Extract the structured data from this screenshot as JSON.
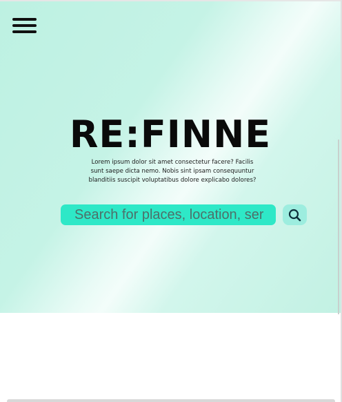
{
  "header": {
    "menu_icon": "hamburger-menu-icon"
  },
  "hero": {
    "title": "RE:FINNE",
    "tagline_lines": [
      "Lorem ipsum dolor sit amet consectetur facere? Facilis",
      "sunt saepe dicta nemo. Nobis sint ipsam consequuntur",
      "blanditiis suscipit voluptatibus dolore explicabo dolores?"
    ]
  },
  "search": {
    "placeholder": "Search for places, location, services...",
    "button_icon": "search-icon"
  },
  "colors": {
    "hero_gradient_mint": "#bdf1e2",
    "search_field": "#2ee8c7",
    "search_button": "#9deddf",
    "title": "#0a0a0a"
  }
}
